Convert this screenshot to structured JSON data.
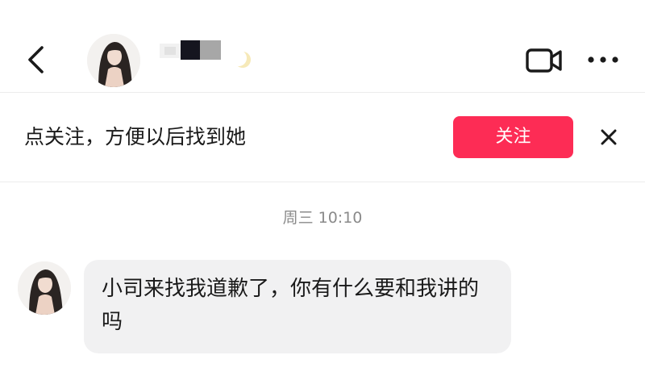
{
  "header": {
    "back_icon": "chevron-left-icon",
    "contact_name": "",
    "status_icon": "crescent-moon-icon",
    "video_call_icon": "video-camera-icon",
    "more_icon": "more-horizontal-icon"
  },
  "follow_bar": {
    "hint": "点关注，方便以后找到她",
    "follow_label": "关注",
    "close_icon": "close-icon"
  },
  "chat": {
    "timestamp": "周三 10:10",
    "messages": [
      {
        "sender": "contact",
        "text": "小司来找我道歉了，你有什么要和我讲的吗"
      }
    ]
  },
  "colors": {
    "accent": "#fd2c55",
    "bubble_bg": "#f1f1f2",
    "muted_text": "#8a8a8a",
    "divider": "#ececec"
  }
}
